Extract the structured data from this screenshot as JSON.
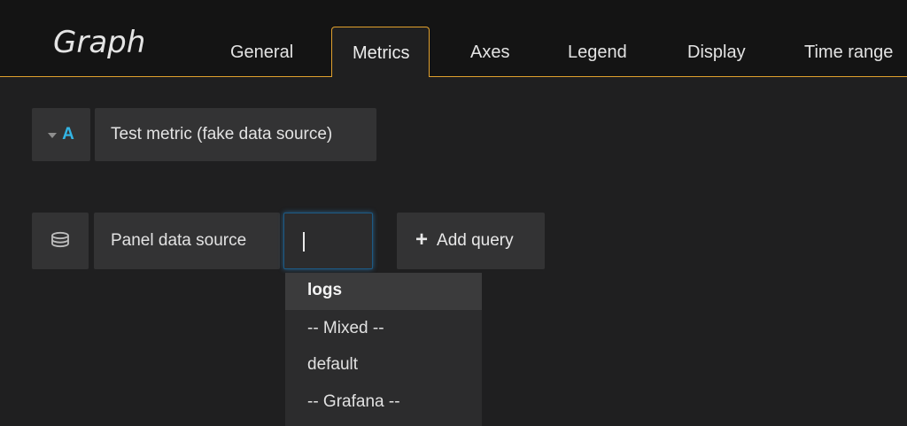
{
  "panel": {
    "title": "Graph"
  },
  "tabs": [
    {
      "label": "General",
      "active": false
    },
    {
      "label": "Metrics",
      "active": true
    },
    {
      "label": "Axes",
      "active": false
    },
    {
      "label": "Legend",
      "active": false
    },
    {
      "label": "Display",
      "active": false
    },
    {
      "label": "Time range",
      "active": false
    }
  ],
  "query": {
    "ref_id": "A",
    "label": "Test metric (fake data source)"
  },
  "datasource_row": {
    "icon": "database-icon",
    "label": "Panel data source",
    "input_value": "",
    "add_query_label": "Add query",
    "add_query_icon": "plus-icon"
  },
  "dropdown": {
    "options": [
      "logs",
      "-- Mixed --",
      "default",
      "-- Grafana --"
    ],
    "highlighted_index": 0
  },
  "colors": {
    "accent_border": "#e0a02d",
    "ref_id": "#33b5e5",
    "focus_glow": "#3399e6",
    "background": "#1f1f20",
    "header_background": "#141414"
  }
}
